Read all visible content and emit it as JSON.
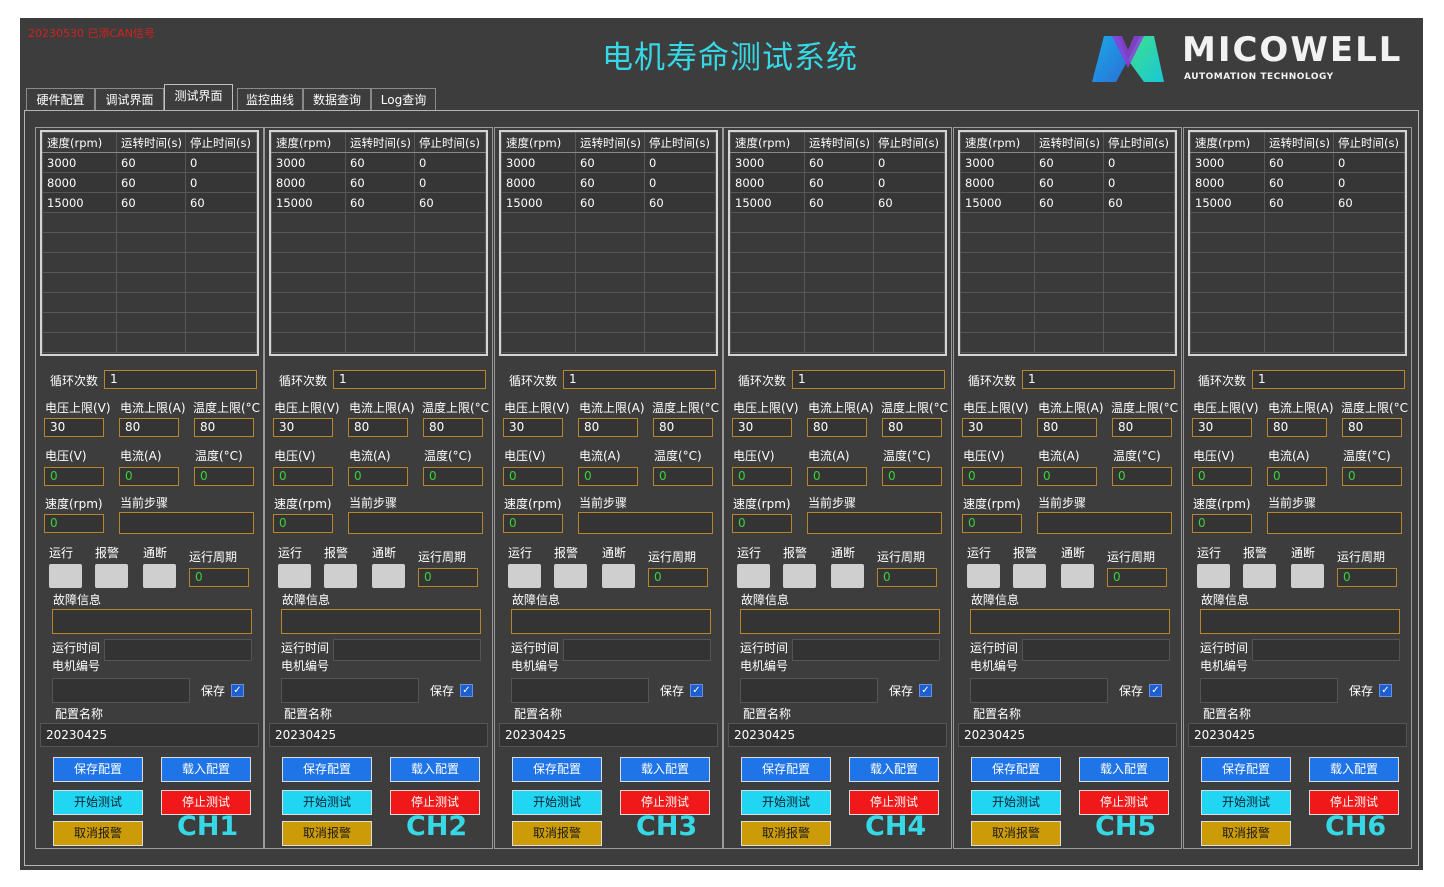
{
  "header": {
    "notice": "20230530 已添CAN信号",
    "title": "电机寿命测试系统",
    "logo_name": "MICOWELL",
    "logo_sub": "AUTOMATION TECHNOLOGY"
  },
  "tabs": [
    {
      "label": "硬件配置"
    },
    {
      "label": "调试界面"
    },
    {
      "label": "测试界面",
      "active": true
    },
    {
      "label": "监控曲线"
    },
    {
      "label": "数据查询"
    },
    {
      "label": "Log查询"
    }
  ],
  "table_headers": [
    "速度(rpm)",
    "运转时间(s)",
    "停止时间(s)"
  ],
  "labels": {
    "cycles": "循环次数",
    "volt_limit": "电压上限(V)",
    "curr_limit": "电流上限(A)",
    "temp_limit": "温度上限(°C",
    "voltage": "电压(V)",
    "current": "电流(A)",
    "temperature": "温度(°C)",
    "speed": "速度(rpm)",
    "current_step": "当前步骤",
    "run": "运行",
    "alarm": "报警",
    "comm_break": "通断",
    "run_cycle": "运行周期",
    "fault_info": "故障信息",
    "run_time": "运行时间",
    "motor_no": "电机编号",
    "save": "保存",
    "config_name": "配置名称"
  },
  "buttons": {
    "save_config": "保存配置",
    "load_config": "载入配置",
    "start_test": "开始测试",
    "stop_test": "停止测试",
    "cancel_alarm": "取消报警"
  },
  "colors": {
    "background": "#3d3d3d",
    "accent": "#35d8e4",
    "field_border": "#b8862a",
    "live_value": "#3ecf3e",
    "save_button": "#1f74e8",
    "start_button": "#20d6f2",
    "stop_button": "#f01818",
    "cancel_button": "#cc9b08"
  },
  "channels": [
    {
      "name": "CH1",
      "rows": [
        [
          "3000",
          "60",
          "0"
        ],
        [
          "8000",
          "60",
          "0"
        ],
        [
          "15000",
          "60",
          "60"
        ]
      ],
      "cycles": "1",
      "volt_limit": "30",
      "curr_limit": "80",
      "temp_limit": "80",
      "voltage": "0",
      "current": "0",
      "temperature": "0",
      "speed": "0",
      "current_step": "",
      "run_cycle": "0",
      "fault_info": "",
      "run_time": "",
      "motor_no": "",
      "save_checked": true,
      "config_name": "20230425"
    },
    {
      "name": "CH2",
      "rows": [
        [
          "3000",
          "60",
          "0"
        ],
        [
          "8000",
          "60",
          "0"
        ],
        [
          "15000",
          "60",
          "60"
        ]
      ],
      "cycles": "1",
      "volt_limit": "30",
      "curr_limit": "80",
      "temp_limit": "80",
      "voltage": "0",
      "current": "0",
      "temperature": "0",
      "speed": "0",
      "current_step": "",
      "run_cycle": "0",
      "fault_info": "",
      "run_time": "",
      "motor_no": "",
      "save_checked": true,
      "config_name": "20230425"
    },
    {
      "name": "CH3",
      "rows": [
        [
          "3000",
          "60",
          "0"
        ],
        [
          "8000",
          "60",
          "0"
        ],
        [
          "15000",
          "60",
          "60"
        ]
      ],
      "cycles": "1",
      "volt_limit": "30",
      "curr_limit": "80",
      "temp_limit": "80",
      "voltage": "0",
      "current": "0",
      "temperature": "0",
      "speed": "0",
      "current_step": "",
      "run_cycle": "0",
      "fault_info": "",
      "run_time": "",
      "motor_no": "",
      "save_checked": true,
      "config_name": "20230425"
    },
    {
      "name": "CH4",
      "rows": [
        [
          "3000",
          "60",
          "0"
        ],
        [
          "8000",
          "60",
          "0"
        ],
        [
          "15000",
          "60",
          "60"
        ]
      ],
      "cycles": "1",
      "volt_limit": "30",
      "curr_limit": "80",
      "temp_limit": "80",
      "voltage": "0",
      "current": "0",
      "temperature": "0",
      "speed": "0",
      "current_step": "",
      "run_cycle": "0",
      "fault_info": "",
      "run_time": "",
      "motor_no": "",
      "save_checked": true,
      "config_name": "20230425"
    },
    {
      "name": "CH5",
      "rows": [
        [
          "3000",
          "60",
          "0"
        ],
        [
          "8000",
          "60",
          "0"
        ],
        [
          "15000",
          "60",
          "60"
        ]
      ],
      "cycles": "1",
      "volt_limit": "30",
      "curr_limit": "80",
      "temp_limit": "80",
      "voltage": "0",
      "current": "0",
      "temperature": "0",
      "speed": "0",
      "current_step": "",
      "run_cycle": "0",
      "fault_info": "",
      "run_time": "",
      "motor_no": "",
      "save_checked": true,
      "config_name": "20230425"
    },
    {
      "name": "CH6",
      "rows": [
        [
          "3000",
          "60",
          "0"
        ],
        [
          "8000",
          "60",
          "0"
        ],
        [
          "15000",
          "60",
          "60"
        ]
      ],
      "cycles": "1",
      "volt_limit": "30",
      "curr_limit": "80",
      "temp_limit": "80",
      "voltage": "0",
      "current": "0",
      "temperature": "0",
      "speed": "0",
      "current_step": "",
      "run_cycle": "0",
      "fault_info": "",
      "run_time": "",
      "motor_no": "",
      "save_checked": true,
      "config_name": "20230425"
    }
  ]
}
